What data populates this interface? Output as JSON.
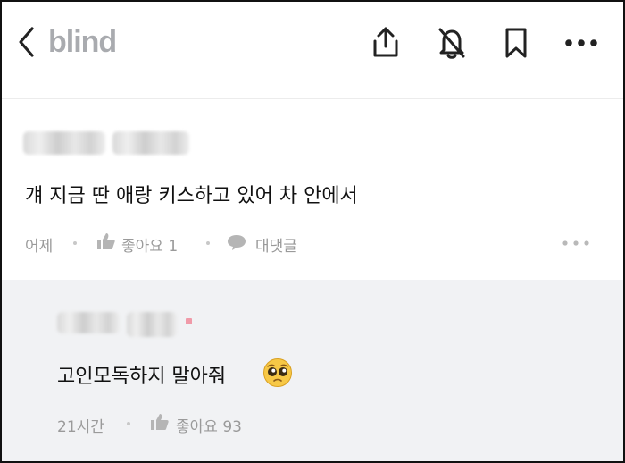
{
  "header": {
    "logo": "blind",
    "icons": [
      "back-chevron-icon",
      "share-icon",
      "bell-off-icon",
      "bookmark-icon",
      "more-icon"
    ]
  },
  "post": {
    "text": "걔 지금 딴 애랑 키스하고 있어 차 안에서",
    "time": "어제",
    "like_label": "좋아요",
    "like_count": "1",
    "reply_label": "대댓글"
  },
  "reply": {
    "text": "고인모독하지 말아줘",
    "time": "21시간",
    "like_label": "좋아요",
    "like_count": "93"
  },
  "colors": {
    "logo": "#a9abaf",
    "reply_background": "#f1f2f4",
    "meta_text": "#9a9a9a"
  }
}
